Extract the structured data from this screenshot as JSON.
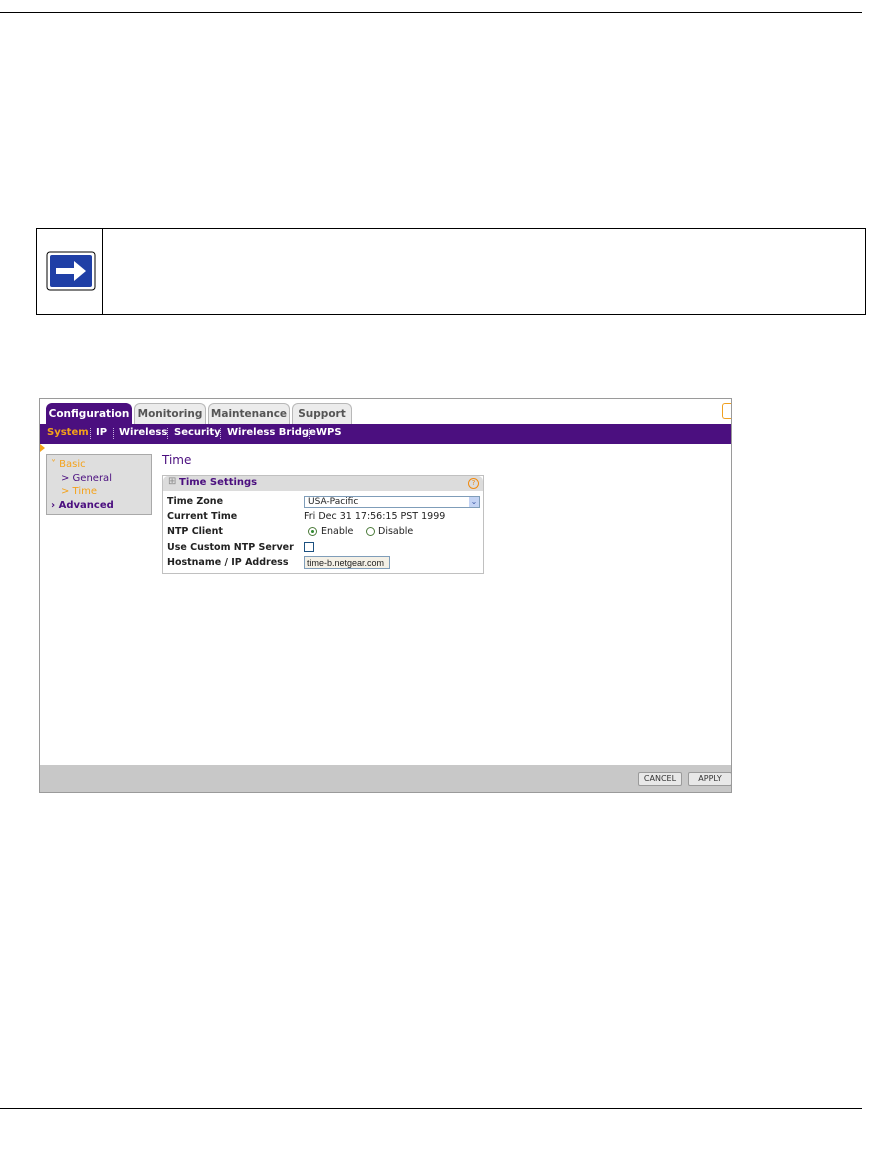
{
  "ui": {
    "tabs": [
      "Configuration",
      "Monitoring",
      "Maintenance",
      "Support"
    ],
    "subnav": [
      "System",
      "IP",
      "Wireless",
      "Security",
      "Wireless Bridge",
      "WPS"
    ],
    "sidebar": {
      "basic": "˅ Basic",
      "general": "> General",
      "time": "> Time",
      "advanced": "› Advanced"
    },
    "page_title": "Time",
    "panel": {
      "plus": "⊞",
      "title": "Time Settings",
      "help": "?",
      "time_zone_label": "Time Zone",
      "time_zone_value": "USA-Pacific",
      "current_time_label": "Current Time",
      "current_time_value": "Fri Dec 31 17:56:15 PST 1999",
      "ntp_client_label": "NTP Client",
      "ntp_enable": "Enable",
      "ntp_disable": "Disable",
      "ntp_selected": "Enable",
      "custom_ntp_label": "Use Custom NTP Server",
      "custom_ntp_checked": false,
      "hostname_label": "Hostname / IP Address",
      "hostname_value": "time-b.netgear.com"
    },
    "buttons": {
      "cancel": "CANCEL",
      "apply": "APPLY"
    },
    "colors": {
      "brand_purple": "#4b0f7f",
      "accent_orange": "#f4a21a"
    }
  }
}
